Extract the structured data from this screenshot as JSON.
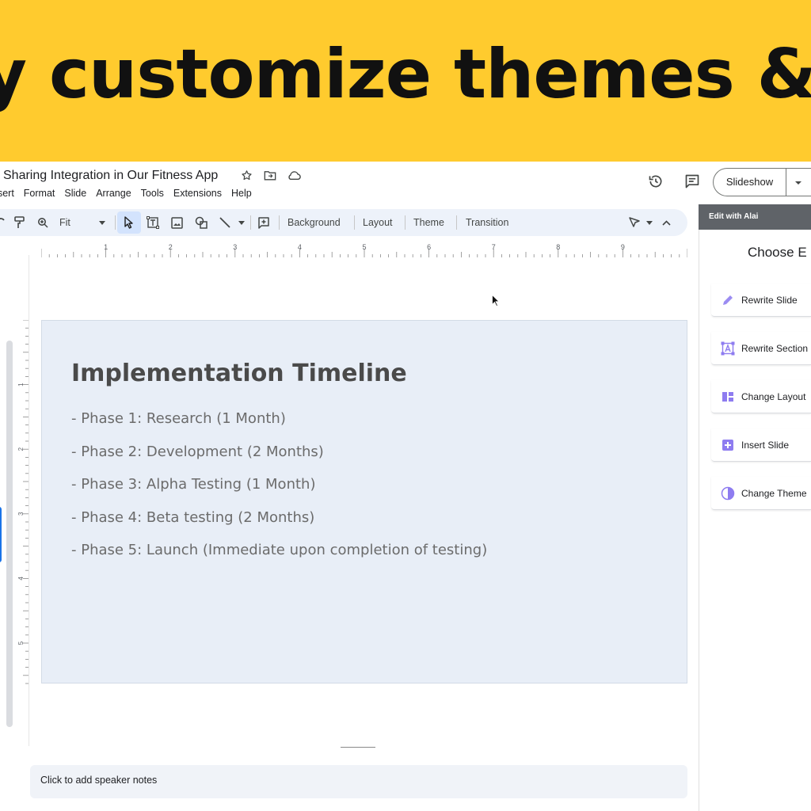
{
  "banner": {
    "text": "y customize themes & l"
  },
  "doc": {
    "title": "Sharing Integration in Our Fitness App",
    "menu": [
      "nsert",
      "Format",
      "Slide",
      "Arrange",
      "Tools",
      "Extensions",
      "Help"
    ]
  },
  "header": {
    "slideshow_label": "Slideshow"
  },
  "toolbar": {
    "zoom": "Fit",
    "background": "Background",
    "layout": "Layout",
    "theme": "Theme",
    "transition": "Transition"
  },
  "rulers": {
    "horizontal": [
      "1",
      "2",
      "3",
      "4",
      "5",
      "6",
      "7",
      "8",
      "9"
    ],
    "vertical": [
      "1",
      "2",
      "3",
      "4",
      "5"
    ]
  },
  "slide": {
    "title": "Implementation Timeline",
    "bullets": [
      "- Phase 1: Research (1 Month)",
      "- Phase 2: Development (2 Months)",
      "- Phase 3: Alpha Testing (1 Month)",
      "- Phase 4: Beta testing (2 Months)",
      "- Phase 5: Launch (Immediate upon completion of testing)"
    ]
  },
  "panel": {
    "header": "Edit with Alai",
    "title": "Choose E",
    "items": [
      {
        "label": "Rewrite Slide",
        "icon": "pencil-icon"
      },
      {
        "label": "Rewrite Section",
        "icon": "text-box-icon"
      },
      {
        "label": "Change Layout",
        "icon": "layout-icon"
      },
      {
        "label": "Insert Slide",
        "icon": "plus-square-icon"
      },
      {
        "label": "Change Theme",
        "icon": "half-circle-icon"
      }
    ]
  },
  "notes": {
    "placeholder": "Click to add speaker notes"
  },
  "colors": {
    "banner": "#FFCB2E",
    "slide_bg": "#e8eef7",
    "panel_header": "#5f6368",
    "panel_accent": "#8e7cf0",
    "toolbar_bg": "#edf2fa"
  }
}
